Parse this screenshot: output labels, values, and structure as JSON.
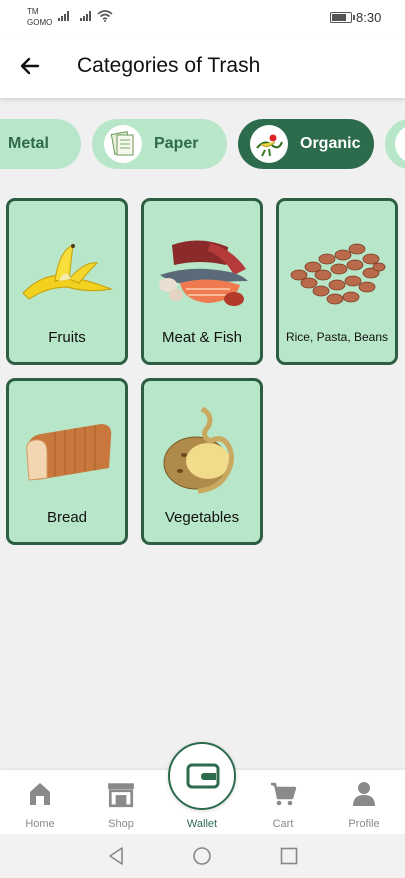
{
  "status_bar": {
    "carrier_line1": "TM",
    "carrier_line2": "GOMO",
    "time": "8:30"
  },
  "header": {
    "title": "Categories of Trash"
  },
  "categories": [
    {
      "label": "Metal",
      "active": false
    },
    {
      "label": "Paper",
      "active": false
    },
    {
      "label": "Organic",
      "active": true
    }
  ],
  "items": [
    {
      "label": "Fruits",
      "icon": "banana-peel-image"
    },
    {
      "label": "Meat & Fish",
      "icon": "meat-fish-image"
    },
    {
      "label": "Rice, Pasta, Beans",
      "icon": "beans-image"
    },
    {
      "label": "Bread",
      "icon": "bread-image"
    },
    {
      "label": "Vegetables",
      "icon": "potato-peel-image"
    }
  ],
  "bottom_nav": {
    "home": "Home",
    "shop": "Shop",
    "wallet": "Wallet",
    "cart": "Cart",
    "profile": "Profile"
  },
  "colors": {
    "accent": "#2d6b4d",
    "card_bg": "#b8e6c8",
    "card_border": "#2d5e43",
    "page_bg": "#f0f0f0"
  }
}
